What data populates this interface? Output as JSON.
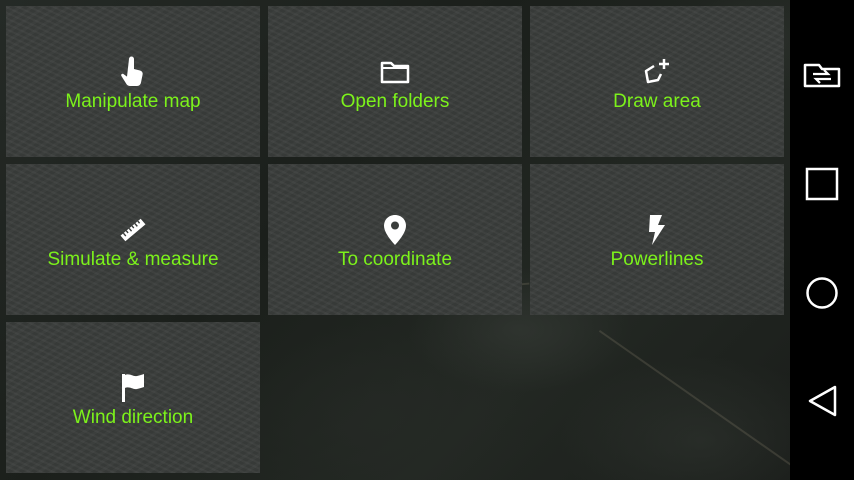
{
  "menu": {
    "tiles": [
      {
        "label": "Manipulate map",
        "icon": "touch-hand-icon"
      },
      {
        "label": "Open folders",
        "icon": "folder-icon"
      },
      {
        "label": "Draw area",
        "icon": "draw-polygon-icon"
      },
      {
        "label": "Simulate & measure",
        "icon": "ruler-icon"
      },
      {
        "label": "To coordinate",
        "icon": "location-pin-icon"
      },
      {
        "label": "Powerlines",
        "icon": "lightning-icon"
      },
      {
        "label": "Wind direction",
        "icon": "flag-icon"
      }
    ]
  },
  "colors": {
    "label_green": "#7cf21b",
    "tile_bg": "#3a3d3b",
    "navbar_bg": "#000000"
  },
  "navbar": {
    "buttons": [
      "switch-app-icon",
      "recents-icon",
      "home-icon",
      "back-icon"
    ]
  }
}
